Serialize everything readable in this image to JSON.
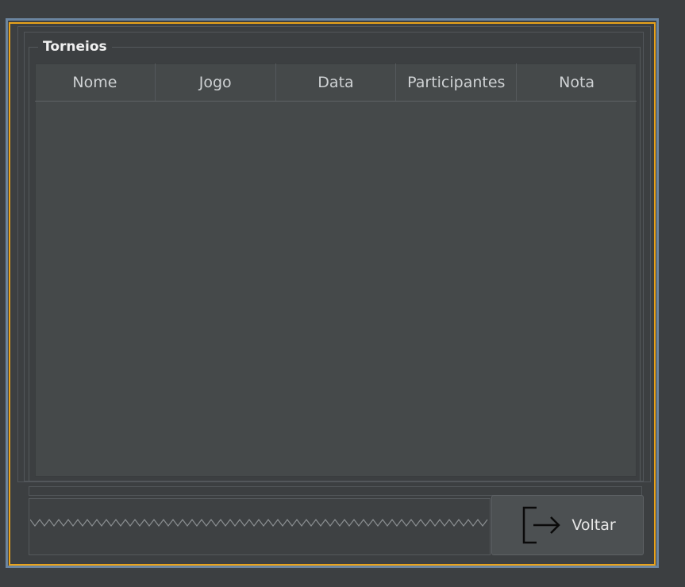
{
  "panel": {
    "title": "Torneios"
  },
  "table": {
    "columns": [
      "Nome",
      "Jogo",
      "Data",
      "Participantes",
      "Nota"
    ],
    "rows": []
  },
  "back_button": {
    "label": "Voltar",
    "icon": "exit-icon"
  },
  "colors": {
    "window_bg": "#3c3f41",
    "table_bg": "#45494a",
    "focus_border": "#e8a21b",
    "outer_border": "#6b85a0"
  }
}
